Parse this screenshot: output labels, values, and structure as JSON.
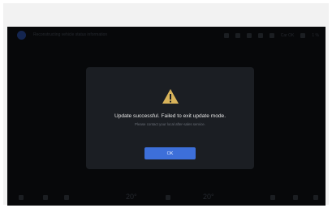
{
  "topbar": {
    "title": "Reconstructing vehicle status information",
    "status_items": [
      "Car OK",
      "1 %"
    ]
  },
  "dialog": {
    "title": "Update successful. Failed to exit update mode.",
    "subtitle": "Please contact your local after-sales service.",
    "ok_label": "OK",
    "icon": "warning-triangle-icon",
    "accent": "#3d6fd9",
    "warning_color": "#d8b35a"
  },
  "bottombar": {
    "left_temp": "20°",
    "right_temp": "20°"
  }
}
